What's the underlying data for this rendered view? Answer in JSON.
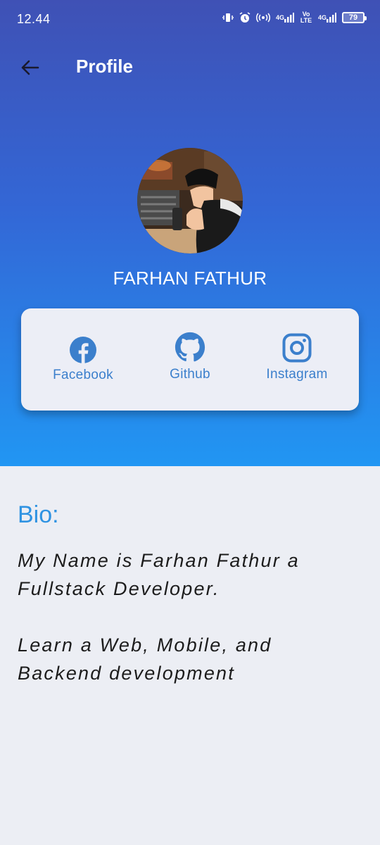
{
  "status_bar": {
    "time": "12.44",
    "network_1": "4G",
    "network_2": "Vo LTE",
    "network_3": "4G",
    "battery": "79"
  },
  "app_bar": {
    "title": "Profile",
    "back_icon": "arrow-left-icon"
  },
  "profile": {
    "name": "FARHAN FATHUR",
    "avatar_icon": "profile-photo"
  },
  "social": {
    "items": [
      {
        "label": "Facebook",
        "icon": "facebook-icon"
      },
      {
        "label": "Github",
        "icon": "github-icon"
      },
      {
        "label": "Instagram",
        "icon": "instagram-icon"
      }
    ]
  },
  "bio": {
    "heading": "Bio:",
    "paragraph_1": "My Name is Farhan Fathur a Fullstack Developer.",
    "paragraph_2": "Learn a Web, Mobile, and Backend development"
  },
  "colors": {
    "gradient_top": "#3f51b5",
    "gradient_bottom": "#2196f3",
    "accent": "#2f93e2",
    "background": "#eceef4"
  }
}
